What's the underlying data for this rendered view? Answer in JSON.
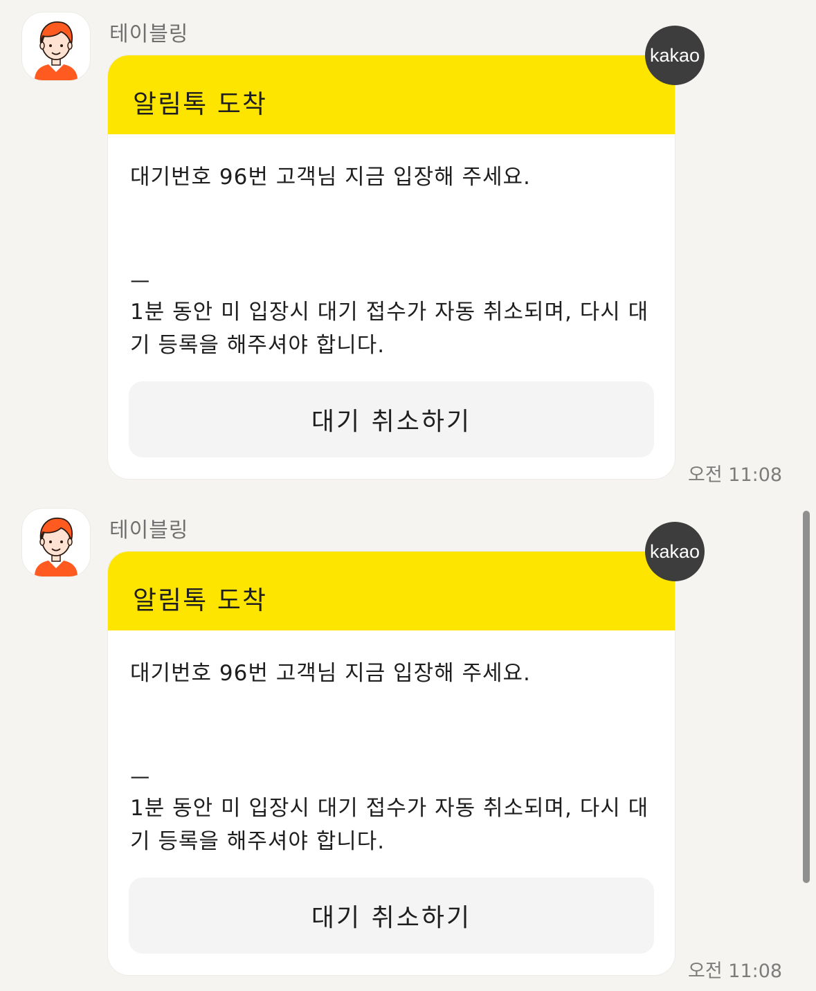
{
  "messages": [
    {
      "sender": "테이블링",
      "badge": "kakao",
      "title": "알림톡 도착",
      "line1": "대기번호 96번 고객님 지금 입장해 주세요.",
      "line2": "ㅡ",
      "line3": "1분 동안 미 입장시 대기 접수가 자동 취소되며, 다시 대",
      "line4": "기 등록을 해주셔야 합니다.",
      "button": "대기 취소하기",
      "time": "오전 11:08"
    },
    {
      "sender": "테이블링",
      "badge": "kakao",
      "title": "알림톡 도착",
      "line1": "대기번호 96번 고객님 지금 입장해 주세요.",
      "line2": "ㅡ",
      "line3": "1분 동안 미 입장시 대기 접수가 자동 취소되며, 다시 대",
      "line4": "기 등록을 해주셔야 합니다.",
      "button": "대기 취소하기",
      "time": "오전 11:08"
    }
  ],
  "colors": {
    "header_yellow": "#fee500",
    "background": "#f5f4f1",
    "badge_dark": "#3d3d3d",
    "avatar_orange": "#ff5a1f"
  },
  "icons": {
    "avatar": "person-avatar-icon",
    "badge": "kakao-badge"
  }
}
